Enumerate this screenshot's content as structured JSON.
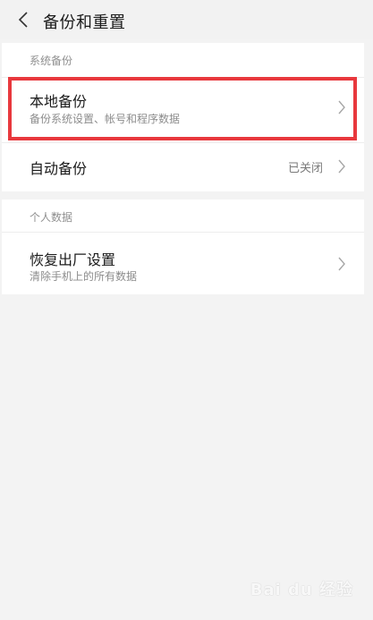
{
  "header": {
    "title": "备份和重置",
    "back_icon": "chevron-left-icon"
  },
  "system_backup": {
    "label": "系统备份",
    "local_backup": {
      "title": "本地备份",
      "subtitle": "备份系统设置、帐号和程序数据"
    },
    "auto_backup": {
      "title": "自动备份",
      "value": "已关闭"
    }
  },
  "personal_data": {
    "label": "个人数据",
    "factory_reset": {
      "title": "恢复出厂设置",
      "subtitle": "清除手机上的所有数据"
    }
  },
  "watermark": "Bai du 经验",
  "colors": {
    "highlight": "#e8383d",
    "background": "#f3f3f3",
    "card": "#ffffff"
  }
}
